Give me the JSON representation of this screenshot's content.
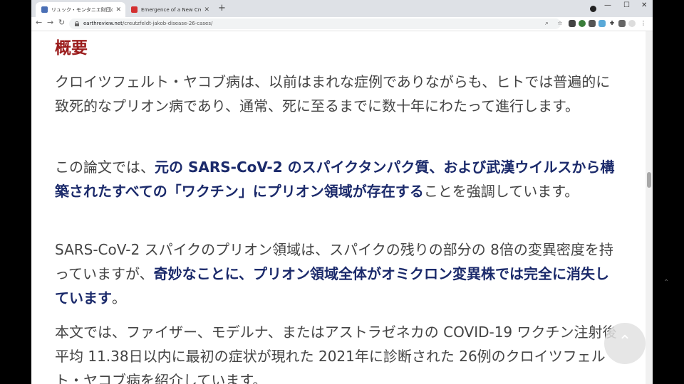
{
  "browser": {
    "tabs": [
      {
        "title": "リュック・モンタニエ財団の科学者た",
        "favicon_color": "#4a6fb5",
        "active": true
      },
      {
        "title": "Emergence of a New Creutzfeldt",
        "favicon_color": "#d32f2f",
        "active": false
      }
    ],
    "new_tab": "+",
    "url_domain": "earthreview.net",
    "url_path": "/creutzfeldt-jakob-disease-26-cases/"
  },
  "article": {
    "heading": "概要",
    "paragraphs": [
      [
        {
          "t": "クロイツフェルト・ヤコブ病は、以前はまれな症例でありながらも、ヒトでは普遍的に致死的なプリオン病であり、通常、死に至るまでに数十年にわたって進行します。",
          "b": false
        }
      ],
      [
        {
          "t": "この論文では、",
          "b": false
        },
        {
          "t": "元の SARS-CoV-2 のスパイクタンパク質、および武漢ウイルスから構築されたすべての「ワクチン」にプリオン領域が存在する",
          "b": true
        },
        {
          "t": "ことを強調しています。",
          "b": false
        }
      ],
      [
        {
          "t": "SARS-CoV-2 スパイクのプリオン領域は、スパイクの残りの部分の 8倍の変異密度を持っていますが、",
          "b": false
        },
        {
          "t": "奇妙なことに、プリオン領域全体がオミクロン変異株では完全に消失しています",
          "b": true
        },
        {
          "t": "。",
          "b": false
        }
      ],
      [
        {
          "t": "本文では、ファイザー、モデルナ、またはアストラゼネカの COVID-19 ワクチン注射後平均 11.38日以内に最初の症状が現れた 2021年に診断された 26例のクロイツフェルト・ヤコブ病を紹介しています。",
          "b": false
        }
      ]
    ]
  },
  "colors": {
    "heading": "#9b1c1c",
    "bold": "#1b2a6b",
    "text": "#444444"
  }
}
